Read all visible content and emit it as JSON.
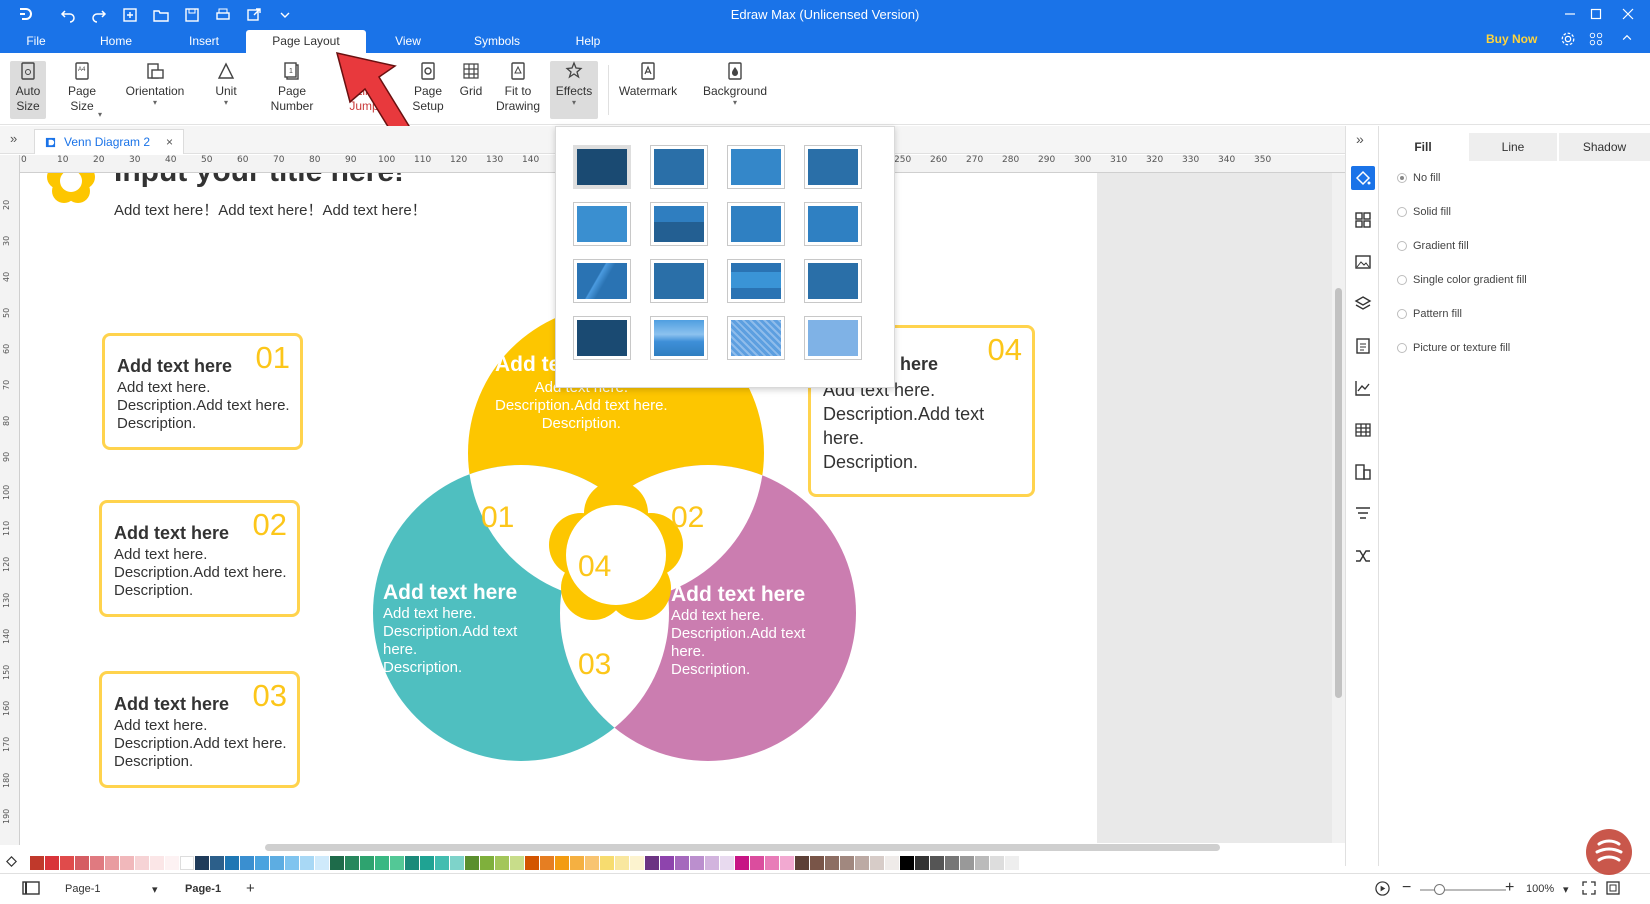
{
  "app": {
    "title": "Edraw Max (Unlicensed Version)",
    "buy_now": "Buy Now"
  },
  "menu": {
    "tabs": [
      {
        "label": "File"
      },
      {
        "label": "Home"
      },
      {
        "label": "Insert"
      },
      {
        "label": "Page Layout"
      },
      {
        "label": "View"
      },
      {
        "label": "Symbols"
      },
      {
        "label": "Help"
      }
    ],
    "active": "Page Layout"
  },
  "ribbon": {
    "auto_size": "Auto Size",
    "page_size": "Page Size",
    "orientation": "Orientation",
    "unit": "Unit",
    "page_number": "Page Number",
    "line_jumps": "Line Jumps",
    "page_setup": "Page Setup",
    "grid": "Grid",
    "fit_to_drawing": "Fit to Drawing",
    "effects": "Effects",
    "watermark": "Watermark",
    "background": "Background"
  },
  "doc_tab": {
    "label": "Venn Diagram 2"
  },
  "rulers": {
    "h": [
      "0",
      "10",
      "20",
      "30",
      "40",
      "50",
      "60",
      "70",
      "80",
      "90",
      "100",
      "110",
      "120",
      "130",
      "140",
      "250",
      "260",
      "270",
      "280",
      "290",
      "300",
      "310",
      "320",
      "330",
      "340",
      "350"
    ],
    "v": [
      "20",
      "30",
      "40",
      "50",
      "60",
      "70",
      "80",
      "90",
      "100",
      "110",
      "120",
      "130",
      "140",
      "150",
      "160",
      "170",
      "180",
      "190"
    ]
  },
  "canvas": {
    "title": "Input your title here!",
    "subtitle": "Add text here！Add text here！Add text here！",
    "boxes": [
      {
        "num": "01",
        "heading": "Add text here",
        "lines": [
          "Add text here.",
          "Description.Add text here.",
          "Description."
        ]
      },
      {
        "num": "02",
        "heading": "Add text here",
        "lines": [
          "Add text here.",
          "Description.Add text here.",
          "Description."
        ]
      },
      {
        "num": "03",
        "heading": "Add text here",
        "lines": [
          "Add text here.",
          "Description.Add text here.",
          "Description."
        ]
      },
      {
        "num": "04",
        "heading": "Add text here",
        "lines": [
          "Add text here.",
          "Description.Add text",
          "here.",
          "Description."
        ]
      }
    ],
    "venn": {
      "top": {
        "heading": "Add text here",
        "lines": [
          "Add text here.",
          "Description.Add text here.",
          "Description."
        ]
      },
      "left": {
        "heading": "Add text here",
        "lines": [
          "Add text here.",
          "Description.Add text",
          "here.",
          "Description."
        ]
      },
      "right": {
        "heading": "Add text here",
        "lines": [
          "Add text here.",
          "Description.Add text",
          "here.",
          "Description."
        ]
      },
      "nums": [
        "01",
        "02",
        "03",
        "04"
      ]
    },
    "colors": {
      "yellow": "#fdc600",
      "teal": "#4fbfc0",
      "pink": "#cb7db0",
      "border": "#ffd34d"
    }
  },
  "effects_popup": {
    "swatches": [
      "#1a4a72",
      "#2a6fa8",
      "#3487c9",
      "#2a6fa8",
      "#3a8fd0",
      "#2a6fa8",
      "#2f80c2",
      "#2f80c2",
      "#2a73b3",
      "#2a6fa8",
      "#3a8fd0",
      "#2a6fa8",
      "#1a4a72",
      "#4f9fe0",
      "#5d9fe0",
      "#7fb2e6"
    ],
    "selected_index": 0
  },
  "side_panel": {
    "tabs": [
      {
        "label": "Fill"
      },
      {
        "label": "Line"
      },
      {
        "label": "Shadow"
      }
    ],
    "fill_options": [
      {
        "label": "No fill",
        "selected": true
      },
      {
        "label": "Solid fill",
        "selected": false
      },
      {
        "label": "Gradient fill",
        "selected": false
      },
      {
        "label": "Single color gradient fill",
        "selected": false
      },
      {
        "label": "Pattern fill",
        "selected": false
      },
      {
        "label": "Picture or texture fill",
        "selected": false
      }
    ]
  },
  "palette": [
    "#c0392b",
    "#d9343a",
    "#e04b4b",
    "#d55d63",
    "#e07a80",
    "#e99ca0",
    "#f1b8bb",
    "#f6d3d5",
    "#fbe6e7",
    "#fdf2f3",
    "#ffffff",
    "#1f3b5a",
    "#2c5f8a",
    "#1f77b4",
    "#3a8fd0",
    "#4aa3df",
    "#5dade2",
    "#7fc4ef",
    "#a8d8f5",
    "#cfeafb",
    "#1e6b4a",
    "#27875d",
    "#2ea36f",
    "#39b883",
    "#53c896",
    "#1b8a7a",
    "#1fa393",
    "#42bdb0",
    "#7ed3ca",
    "#5a8f2e",
    "#7fb03c",
    "#a3c65a",
    "#c8dd8a",
    "#d35400",
    "#e67e22",
    "#f39c12",
    "#f5b041",
    "#f8c471",
    "#f7dc6f",
    "#f9e79f",
    "#fcf3cf",
    "#6c3483",
    "#8e44ad",
    "#a569bd",
    "#bb8fce",
    "#d2b4de",
    "#e8daef",
    "#c71585",
    "#db4d9e",
    "#e87cb8",
    "#f2a9d1",
    "#5d4037",
    "#795548",
    "#8d6e63",
    "#a1887f",
    "#bcaaa4",
    "#d7ccc8",
    "#efebe9",
    "#000000",
    "#333333",
    "#555555",
    "#777777",
    "#999999",
    "#bbbbbb",
    "#dddddd",
    "#eeeeee"
  ],
  "status": {
    "page_selector": "Page-1",
    "page_tab": "Page-1",
    "zoom": "100%"
  }
}
